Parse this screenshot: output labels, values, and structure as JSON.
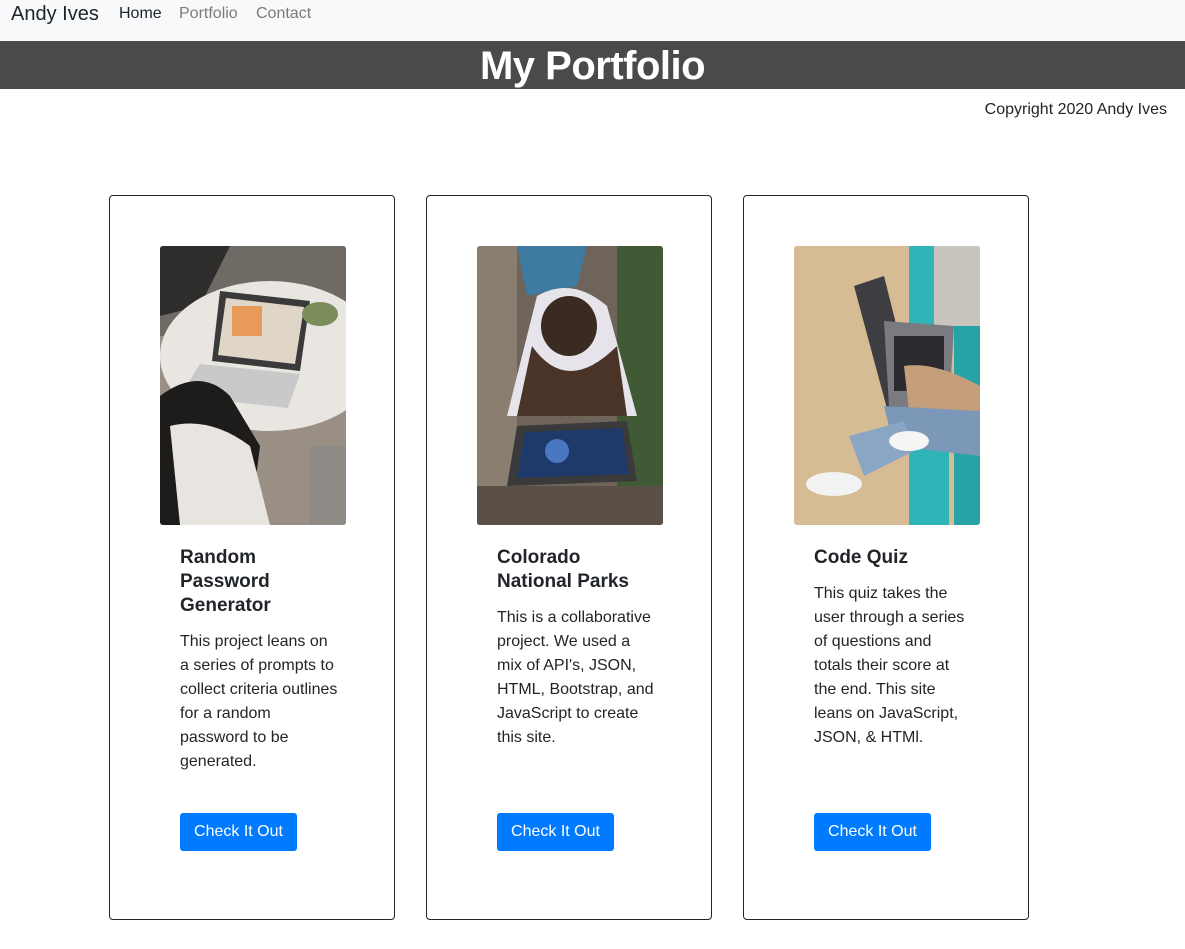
{
  "navbar": {
    "brand": "Andy Ives",
    "links": [
      {
        "label": "Home",
        "active": true
      },
      {
        "label": "Portfolio",
        "active": false
      },
      {
        "label": "Contact",
        "active": false
      }
    ]
  },
  "banner": {
    "title": "My Portfolio"
  },
  "copyright": "Copyright 2020 Andy Ives",
  "cards": [
    {
      "title": "Random Password Generator",
      "text": "This project leans on a series of prompts to collect criteria outlines for a random password to be generated.",
      "button": "Check It Out",
      "image": "photo-laptop-table-icon"
    },
    {
      "title": "Colorado National Parks",
      "text": "This is a collaborative project. We used a mix of API's, JSON, HTML, Bootstrap, and JavaScript to create this site.",
      "button": "Check It Out",
      "image": "photo-woman-laptop-ground-icon"
    },
    {
      "title": "Code Quiz",
      "text": "This quiz takes the user through a series of questions and totals their score at the end. This site leans on JavaScript, JSON, & HTMl.",
      "button": "Check It Out",
      "image": "photo-laptop-bench-icon"
    }
  ],
  "colors": {
    "navbar_bg": "#f8f9fa",
    "banner_bg": "#4a4a4a",
    "button_bg": "#007bff",
    "card_border": "#212529"
  }
}
